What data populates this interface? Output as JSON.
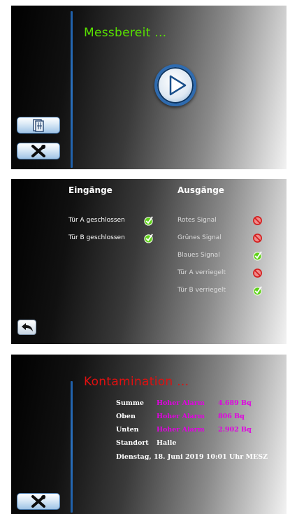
{
  "screen1": {
    "heading": "Messbereit ...",
    "play_icon": "play-icon",
    "button_a_icon": "door-icon",
    "button_b_icon": "tools-icon"
  },
  "screen2": {
    "inputs_heading": "Eingänge",
    "outputs_heading": "Ausgänge",
    "inputs": [
      {
        "label": "Tür A geschlossen",
        "state": "ok"
      },
      {
        "label": "Tür B geschlossen",
        "state": "ok"
      }
    ],
    "outputs": [
      {
        "label": "Rotes Signal",
        "state": "off"
      },
      {
        "label": "Grünes Signal",
        "state": "off"
      },
      {
        "label": "Blaues Signal",
        "state": "ok"
      },
      {
        "label": "Tür A verriegelt",
        "state": "off"
      },
      {
        "label": "Tür B verriegelt",
        "state": "ok"
      }
    ],
    "back_icon": "back-arrow-icon"
  },
  "screen3": {
    "heading": "Kontamination ...",
    "rows": [
      {
        "label": "Summe",
        "alarm": "Hoher Alarm",
        "value": "4.689 Bq"
      },
      {
        "label": "Oben",
        "alarm": "Hoher Alarm",
        "value": "806 Bq"
      },
      {
        "label": "Unten",
        "alarm": "Hoher Alarm",
        "value": "2.902 Bq"
      }
    ],
    "location_label": "Standort",
    "location_value": "Halle",
    "datetime": "Dienstag, 18. Juni 2019 10:01 Uhr MESZ",
    "tools_icon": "tools-icon"
  },
  "colors": {
    "ready_green": "#58e000",
    "alarm_red": "#e01010",
    "alarm_magenta": "#e200e2",
    "divider_blue": "#2a70bd",
    "ok_green": "#5fd11a",
    "off_red": "#d42020"
  }
}
